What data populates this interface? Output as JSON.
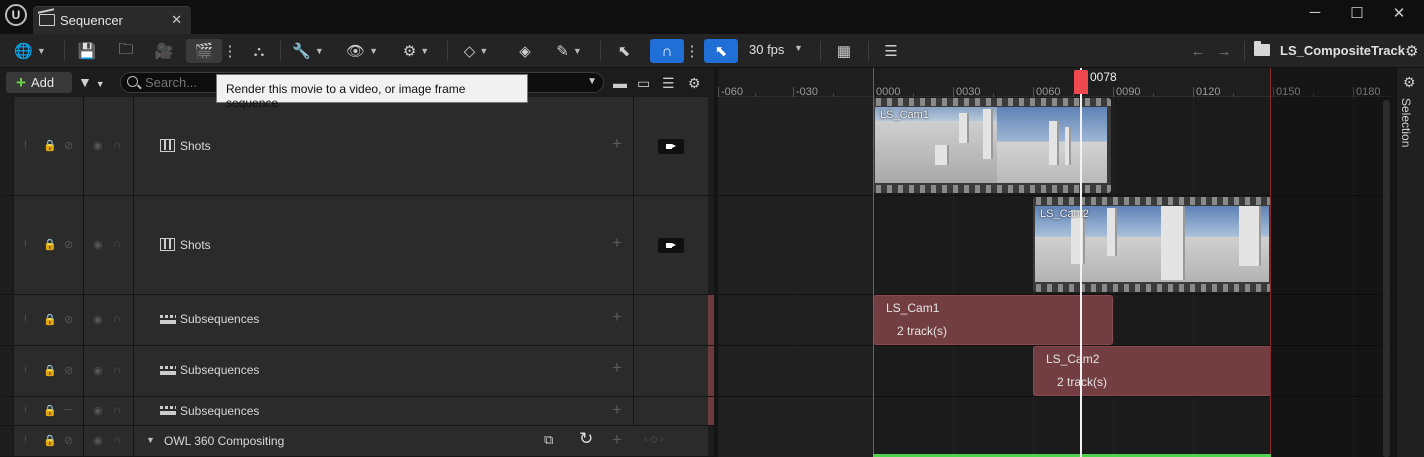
{
  "window": {
    "tab_title": "Sequencer",
    "close_symbol": "✕",
    "minimize_symbol": "─",
    "maximize_symbol": "☐",
    "window_close_symbol": "✕"
  },
  "toolbar": {
    "fps": "30 fps",
    "sequence_name": "LS_CompositeTrack",
    "icons": [
      "world-icon",
      "save-icon",
      "browse-icon",
      "camera-icon",
      "render-movie-icon",
      "more-icon",
      "sequence-hierarchy-icon",
      "wrench-icon",
      "eye-icon",
      "gear-icon",
      "key-icon",
      "auto-key-icon",
      "pen-icon",
      "selection-cursor-icon",
      "snap-magnet-icon",
      "snap-playhead-icon",
      "grid-icon",
      "lock-view-icon",
      "back-arrow-icon",
      "forward-arrow-icon",
      "folder-icon",
      "settings-icon"
    ],
    "active_button": "render-movie-icon",
    "snap_enabled": true,
    "accent_color": "#1f6fd6"
  },
  "outliner": {
    "add_label": "Add",
    "search_placeholder": "Search..."
  },
  "tooltip": {
    "text": "Render this movie to a video, or image frame sequence"
  },
  "tracks": [
    {
      "type": "shots",
      "label": "Shots"
    },
    {
      "type": "shots",
      "label": "Shots"
    },
    {
      "type": "subsequences",
      "label": "Subsequences"
    },
    {
      "type": "subsequences",
      "label": "Subsequences"
    },
    {
      "type": "subsequences",
      "label": "Subsequences"
    },
    {
      "type": "folder",
      "label": "OWL 360 Compositing"
    }
  ],
  "timeline": {
    "current_frame": "0078",
    "ruler_labels": [
      "-060",
      "-030",
      "0000",
      "0030",
      "0060",
      "0090",
      "0120",
      "0150",
      "0180"
    ],
    "playhead_color": "#f0484f",
    "shots": [
      {
        "name": "LS_Cam1"
      },
      {
        "name": "LS_Cam2"
      }
    ],
    "subsequences": [
      {
        "name": "LS_Cam1",
        "tracks": "2 track(s)"
      },
      {
        "name": "LS_Cam2",
        "tracks": "2 track(s)"
      }
    ]
  },
  "side_panel": {
    "label": "Selection"
  }
}
